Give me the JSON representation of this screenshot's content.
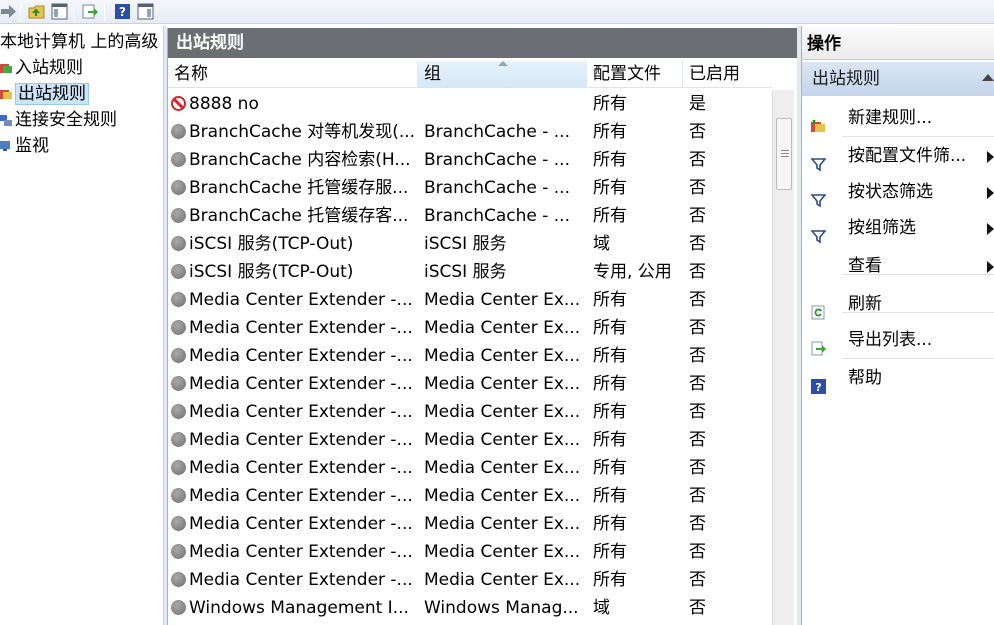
{
  "tree": {
    "root_label": "本地计算机 上的高级",
    "items": [
      {
        "label": "入站规则",
        "icon": "inbound-rules-icon"
      },
      {
        "label": "出站规则",
        "icon": "outbound-rules-icon",
        "selected": true
      },
      {
        "label": "连接安全规则",
        "icon": "connection-security-icon"
      },
      {
        "label": "监视",
        "icon": "monitor-icon"
      }
    ]
  },
  "center": {
    "title": "出站规则",
    "columns": [
      "名称",
      "组",
      "配置文件",
      "已启用"
    ],
    "rows": [
      {
        "name": "8888 no",
        "group": "",
        "profile": "所有",
        "enabled": "是",
        "icon": "block-icon"
      },
      {
        "name": "BranchCache 对等机发现(...",
        "group": "BranchCache - ...",
        "profile": "所有",
        "enabled": "否",
        "icon": "rule-disabled-icon"
      },
      {
        "name": "BranchCache 内容检索(H...",
        "group": "BranchCache - ...",
        "profile": "所有",
        "enabled": "否",
        "icon": "rule-disabled-icon"
      },
      {
        "name": "BranchCache 托管缓存服...",
        "group": "BranchCache - ...",
        "profile": "所有",
        "enabled": "否",
        "icon": "rule-disabled-icon"
      },
      {
        "name": "BranchCache 托管缓存客...",
        "group": "BranchCache - ...",
        "profile": "所有",
        "enabled": "否",
        "icon": "rule-disabled-icon"
      },
      {
        "name": "iSCSI 服务(TCP-Out)",
        "group": "iSCSI 服务",
        "profile": "域",
        "enabled": "否",
        "icon": "rule-disabled-icon"
      },
      {
        "name": "iSCSI 服务(TCP-Out)",
        "group": "iSCSI 服务",
        "profile": "专用, 公用",
        "enabled": "否",
        "icon": "rule-disabled-icon"
      },
      {
        "name": "Media Center Extender -...",
        "group": "Media Center Ex...",
        "profile": "所有",
        "enabled": "否",
        "icon": "rule-disabled-icon"
      },
      {
        "name": "Media Center Extender -...",
        "group": "Media Center Ex...",
        "profile": "所有",
        "enabled": "否",
        "icon": "rule-disabled-icon"
      },
      {
        "name": "Media Center Extender -...",
        "group": "Media Center Ex...",
        "profile": "所有",
        "enabled": "否",
        "icon": "rule-disabled-icon"
      },
      {
        "name": "Media Center Extender -...",
        "group": "Media Center Ex...",
        "profile": "所有",
        "enabled": "否",
        "icon": "rule-disabled-icon"
      },
      {
        "name": "Media Center Extender -...",
        "group": "Media Center Ex...",
        "profile": "所有",
        "enabled": "否",
        "icon": "rule-disabled-icon"
      },
      {
        "name": "Media Center Extender -...",
        "group": "Media Center Ex...",
        "profile": "所有",
        "enabled": "否",
        "icon": "rule-disabled-icon"
      },
      {
        "name": "Media Center Extender -...",
        "group": "Media Center Ex...",
        "profile": "所有",
        "enabled": "否",
        "icon": "rule-disabled-icon"
      },
      {
        "name": "Media Center Extender -...",
        "group": "Media Center Ex...",
        "profile": "所有",
        "enabled": "否",
        "icon": "rule-disabled-icon"
      },
      {
        "name": "Media Center Extender -...",
        "group": "Media Center Ex...",
        "profile": "所有",
        "enabled": "否",
        "icon": "rule-disabled-icon"
      },
      {
        "name": "Media Center Extender -...",
        "group": "Media Center Ex...",
        "profile": "所有",
        "enabled": "否",
        "icon": "rule-disabled-icon"
      },
      {
        "name": "Media Center Extender -...",
        "group": "Media Center Ex...",
        "profile": "所有",
        "enabled": "否",
        "icon": "rule-disabled-icon"
      },
      {
        "name": "Windows Management I...",
        "group": "Windows Manag...",
        "profile": "域",
        "enabled": "否",
        "icon": "rule-disabled-icon"
      }
    ]
  },
  "actions": {
    "title": "操作",
    "section": "出站规则",
    "items": [
      {
        "label": "新建规则...",
        "icon": "new-rule-icon",
        "submenu": false
      },
      {
        "label": "按配置文件筛...",
        "icon": "filter-icon",
        "submenu": true
      },
      {
        "label": "按状态筛选",
        "icon": "filter-icon",
        "submenu": true
      },
      {
        "label": "按组筛选",
        "icon": "filter-icon",
        "submenu": true
      },
      {
        "label": "查看",
        "icon": "",
        "submenu": true
      },
      {
        "label": "刷新",
        "icon": "refresh-icon",
        "submenu": false
      },
      {
        "label": "导出列表...",
        "icon": "export-list-icon",
        "submenu": false
      },
      {
        "label": "帮助",
        "icon": "help-icon",
        "submenu": false
      }
    ]
  },
  "colors": {
    "title_bar": "#6b6e73",
    "selection": "#cce4f7",
    "section_header": "#c3d4ea",
    "block": "#dd2222"
  }
}
